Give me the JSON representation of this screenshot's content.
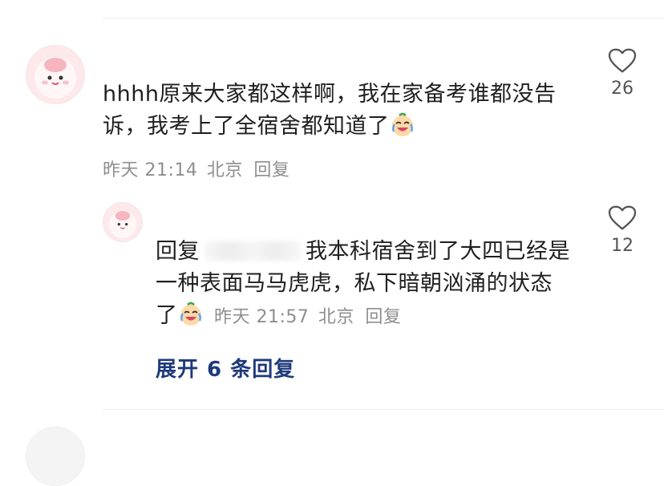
{
  "comment": {
    "text_line1": "hhhh原来大家都这样啊，我在家备考谁都没告",
    "text_line2": "诉，我考上了全宿舍都知道了",
    "time": "昨天 21:14",
    "location": "北京",
    "reply_label": "回复",
    "like_count": "26",
    "emoji_icon": "crying-laughing-emoji"
  },
  "reply": {
    "prefix": "回复",
    "text_line1_rest": "我本科宿舍到了大四已经是",
    "text_line2": "一种表面马马虎虎，私下暗朝汹涌的状态",
    "text_line3_start": "了",
    "time": "昨天 21:57",
    "location": "北京",
    "reply_label": "回复",
    "like_count": "12",
    "emoji_icon": "crying-laughing-emoji"
  },
  "expand_label": "展开 6 条回复",
  "colors": {
    "link": "#1e3a7a",
    "meta": "#8e8e8e",
    "avatar_bg": "#fde8ea"
  }
}
